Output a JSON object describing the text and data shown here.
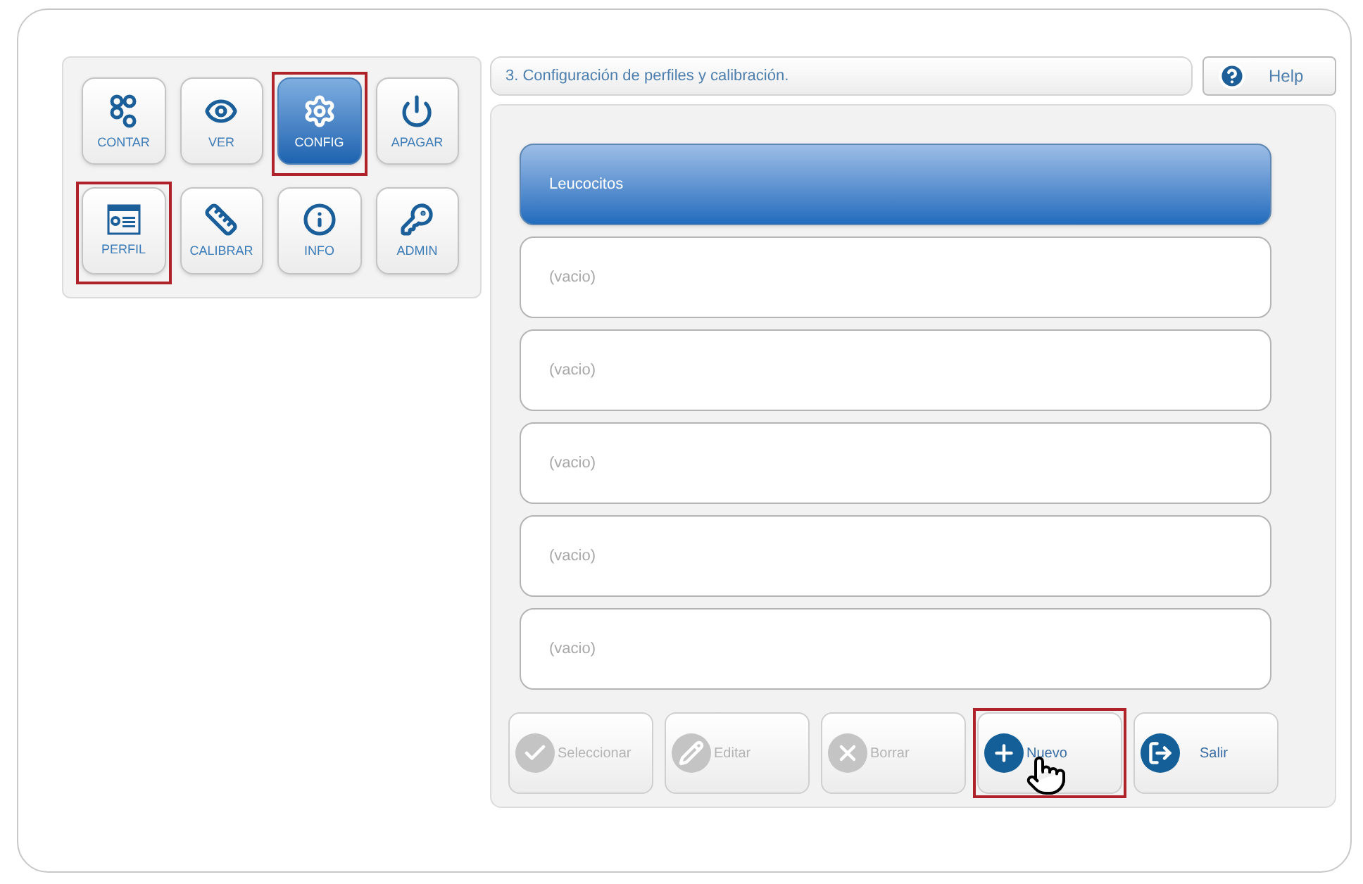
{
  "menu": [
    {
      "label": "CONTAR",
      "kind": "count",
      "selected": false,
      "highlighted": false
    },
    {
      "label": "VER",
      "kind": "view",
      "selected": false,
      "highlighted": false
    },
    {
      "label": "CONFIG",
      "kind": "config",
      "selected": true,
      "highlighted": true
    },
    {
      "label": "APAGAR",
      "kind": "power",
      "selected": false,
      "highlighted": false
    },
    {
      "label": "PERFIL",
      "kind": "profile",
      "selected": false,
      "highlighted": true
    },
    {
      "label": "CALIBRAR",
      "kind": "ruler",
      "selected": false,
      "highlighted": false
    },
    {
      "label": "INFO",
      "kind": "info",
      "selected": false,
      "highlighted": false
    },
    {
      "label": "ADMIN",
      "kind": "key",
      "selected": false,
      "highlighted": false
    }
  ],
  "header": {
    "title": "3. Configuración de perfiles y calibración."
  },
  "help": {
    "label": "Help"
  },
  "profiles": [
    {
      "label": "Leucocitos",
      "selected": true
    },
    {
      "label": "(vacio)",
      "selected": false
    },
    {
      "label": "(vacio)",
      "selected": false
    },
    {
      "label": "(vacio)",
      "selected": false
    },
    {
      "label": "(vacio)",
      "selected": false
    },
    {
      "label": "(vacio)",
      "selected": false
    }
  ],
  "actions": [
    {
      "label": "Seleccionar",
      "kind": "check",
      "disabled": true,
      "highlighted": false
    },
    {
      "label": "Editar",
      "kind": "edit",
      "disabled": true,
      "highlighted": false
    },
    {
      "label": "Borrar",
      "kind": "delete",
      "disabled": true,
      "highlighted": false
    },
    {
      "label": "Nuevo",
      "kind": "new",
      "disabled": false,
      "highlighted": true
    },
    {
      "label": "Salir",
      "kind": "exit",
      "disabled": false,
      "highlighted": false
    }
  ]
}
